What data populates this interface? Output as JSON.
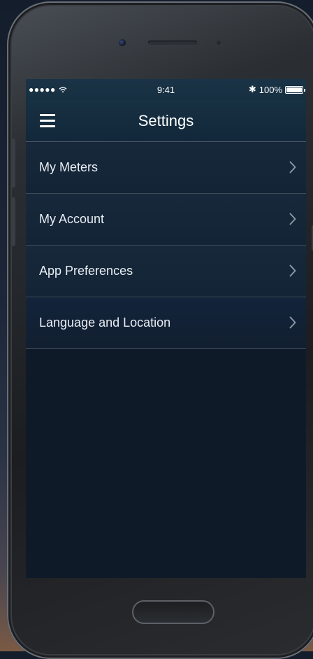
{
  "status_bar": {
    "signal": "●●●●● ",
    "time": "9:41",
    "bluetooth": "✱",
    "battery_percent": "100%",
    "battery_level": 1.0
  },
  "nav": {
    "title": "Settings",
    "menu_icon": "hamburger-icon"
  },
  "menu": {
    "items": [
      {
        "label": "My Meters",
        "icon": "chevron-right-icon"
      },
      {
        "label": "My Account",
        "icon": "chevron-right-icon"
      },
      {
        "label": "App Preferences",
        "icon": "chevron-right-icon"
      },
      {
        "label": "Language and Location",
        "icon": "chevron-right-icon"
      }
    ]
  },
  "colors": {
    "nav_background": "#173042",
    "screen_background": "#0e1826",
    "divider": "#3f4c5a",
    "text": "#e9eef3",
    "chevron": "#8a96a3"
  }
}
